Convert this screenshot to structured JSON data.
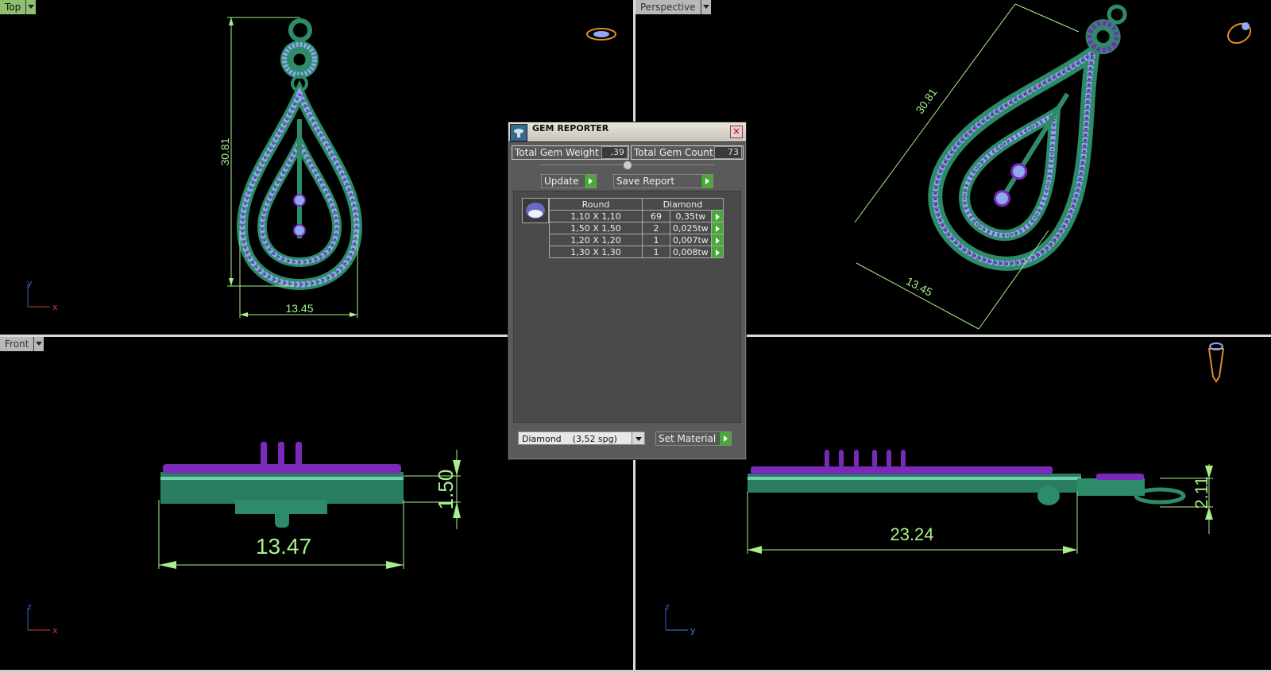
{
  "viewports": {
    "top": {
      "label": "Top"
    },
    "perspective": {
      "label": "Perspective"
    },
    "front": {
      "label": "Front"
    }
  },
  "dimensions": {
    "top_height": "30.81",
    "top_width": "13.45",
    "persp_height": "30.81",
    "persp_width": "13.45",
    "front_width": "13.47",
    "front_thickness": "1.50",
    "side_length": "23.24",
    "side_thickness": "2.11"
  },
  "axes": {
    "x": "x",
    "y": "y",
    "z": "z"
  },
  "gem_reporter": {
    "title": "GEM REPORTER",
    "total_weight_label": "Total Gem Weight",
    "total_weight_value": ",39",
    "total_count_label": "Total Gem Count",
    "total_count_value": "73",
    "update_label": "Update",
    "save_report_label": "Save Report",
    "table": {
      "headers": [
        "Round",
        "Diamond"
      ],
      "rows": [
        {
          "size": "1,10 X 1,10",
          "count": "69",
          "weight": "0,35tw"
        },
        {
          "size": "1,50 X 1,50",
          "count": "2",
          "weight": "0,025tw"
        },
        {
          "size": "1,20 X 1,20",
          "count": "1",
          "weight": "0,007tw"
        },
        {
          "size": "1,30 X 1,30",
          "count": "1",
          "weight": "0,008tw"
        }
      ]
    },
    "material_select": "Diamond    (3,52 spg)",
    "set_material_label": "Set Material"
  },
  "colors": {
    "metal": "#2e8b6a",
    "gem_light": "#8fa8f0",
    "gem_purple": "#7a2ab8",
    "dimension": "#a8f08a"
  }
}
